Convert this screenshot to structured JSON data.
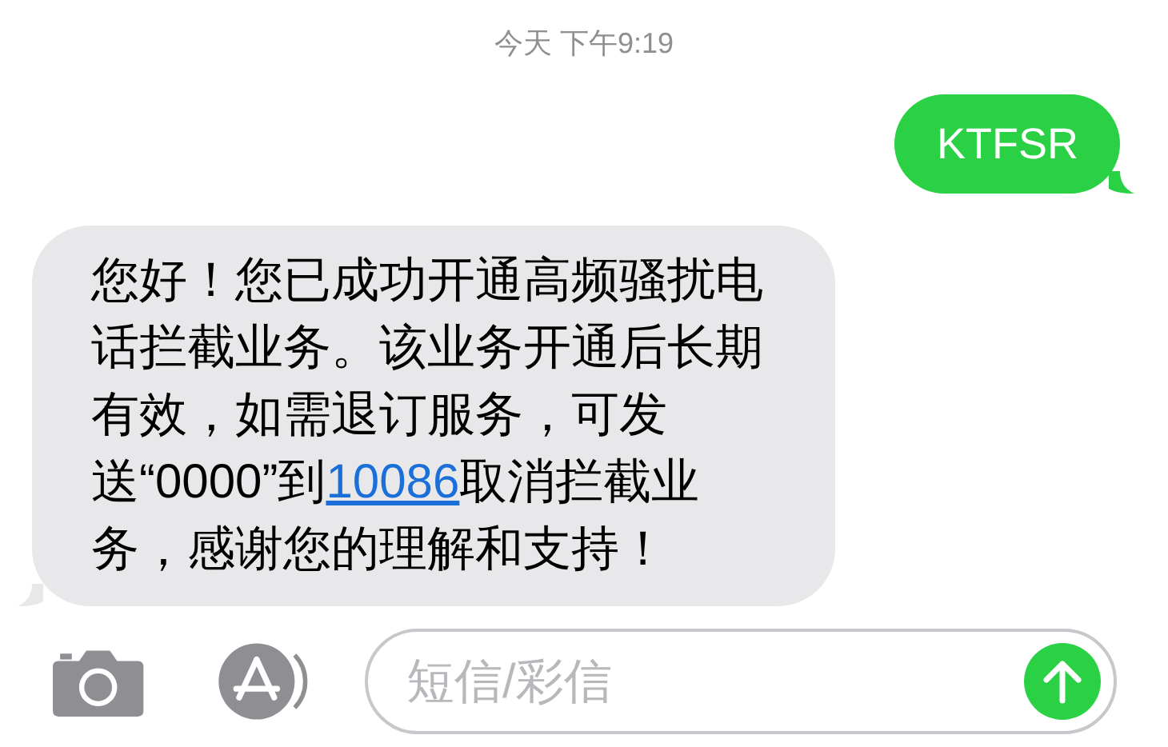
{
  "timestamp": "今天 下午9:19",
  "messages": [
    {
      "kind": "outgoing",
      "text": "KTFSR"
    },
    {
      "kind": "incoming",
      "text": "您好！您已成功开通高频骚扰电话拦截业务。该业务开通后长期有效，如需退订服务，可发送“0000”到",
      "link": "10086",
      "text_after": "取消拦截业务，感谢您的理解和支持！"
    }
  ],
  "composer": {
    "placeholder": "短信/彩信"
  }
}
